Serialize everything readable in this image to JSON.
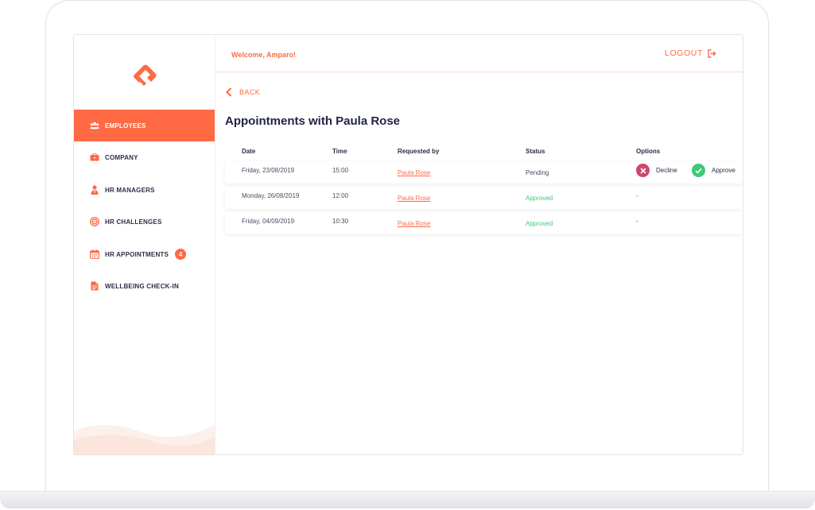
{
  "brand": {
    "accent": "#ff6a45",
    "approved_color": "#3ec97a",
    "decline_color": "#c94a6a"
  },
  "header": {
    "welcome": "Welcome, Amparo!",
    "logout_label": "LOGOUT"
  },
  "sidebar": {
    "items": [
      {
        "label": "EMPLOYEES",
        "icon": "people-icon",
        "active": true
      },
      {
        "label": "COMPANY",
        "icon": "briefcase-icon"
      },
      {
        "label": "HR MANAGERS",
        "icon": "manager-icon"
      },
      {
        "label": "HR CHALLENGES",
        "icon": "target-icon"
      },
      {
        "label": "HR APPOINTMENTS",
        "icon": "calendar-icon",
        "badge": "4"
      },
      {
        "label": "WELLBEING CHECK-IN",
        "icon": "document-icon"
      }
    ]
  },
  "main": {
    "back_label": "BACK",
    "title": "Appointments with Paula Rose",
    "table": {
      "headers": [
        "Date",
        "Time",
        "Requested by",
        "Status",
        "Options"
      ],
      "rows": [
        {
          "date": "Friday, 23/08/2019",
          "time": "15:00",
          "requested_by": "Paula Rose",
          "status": "Pending",
          "options": [
            "Decline",
            "Approve"
          ]
        },
        {
          "date": "Monday, 26/08/2019",
          "time": "12:00",
          "requested_by": "Paula Rose",
          "status": "Approved",
          "options_text": "-"
        },
        {
          "date": "Friday, 04/09/2019",
          "time": "10:30",
          "requested_by": "Paula Rose",
          "status": "Approved",
          "options_text": "-"
        }
      ]
    }
  }
}
